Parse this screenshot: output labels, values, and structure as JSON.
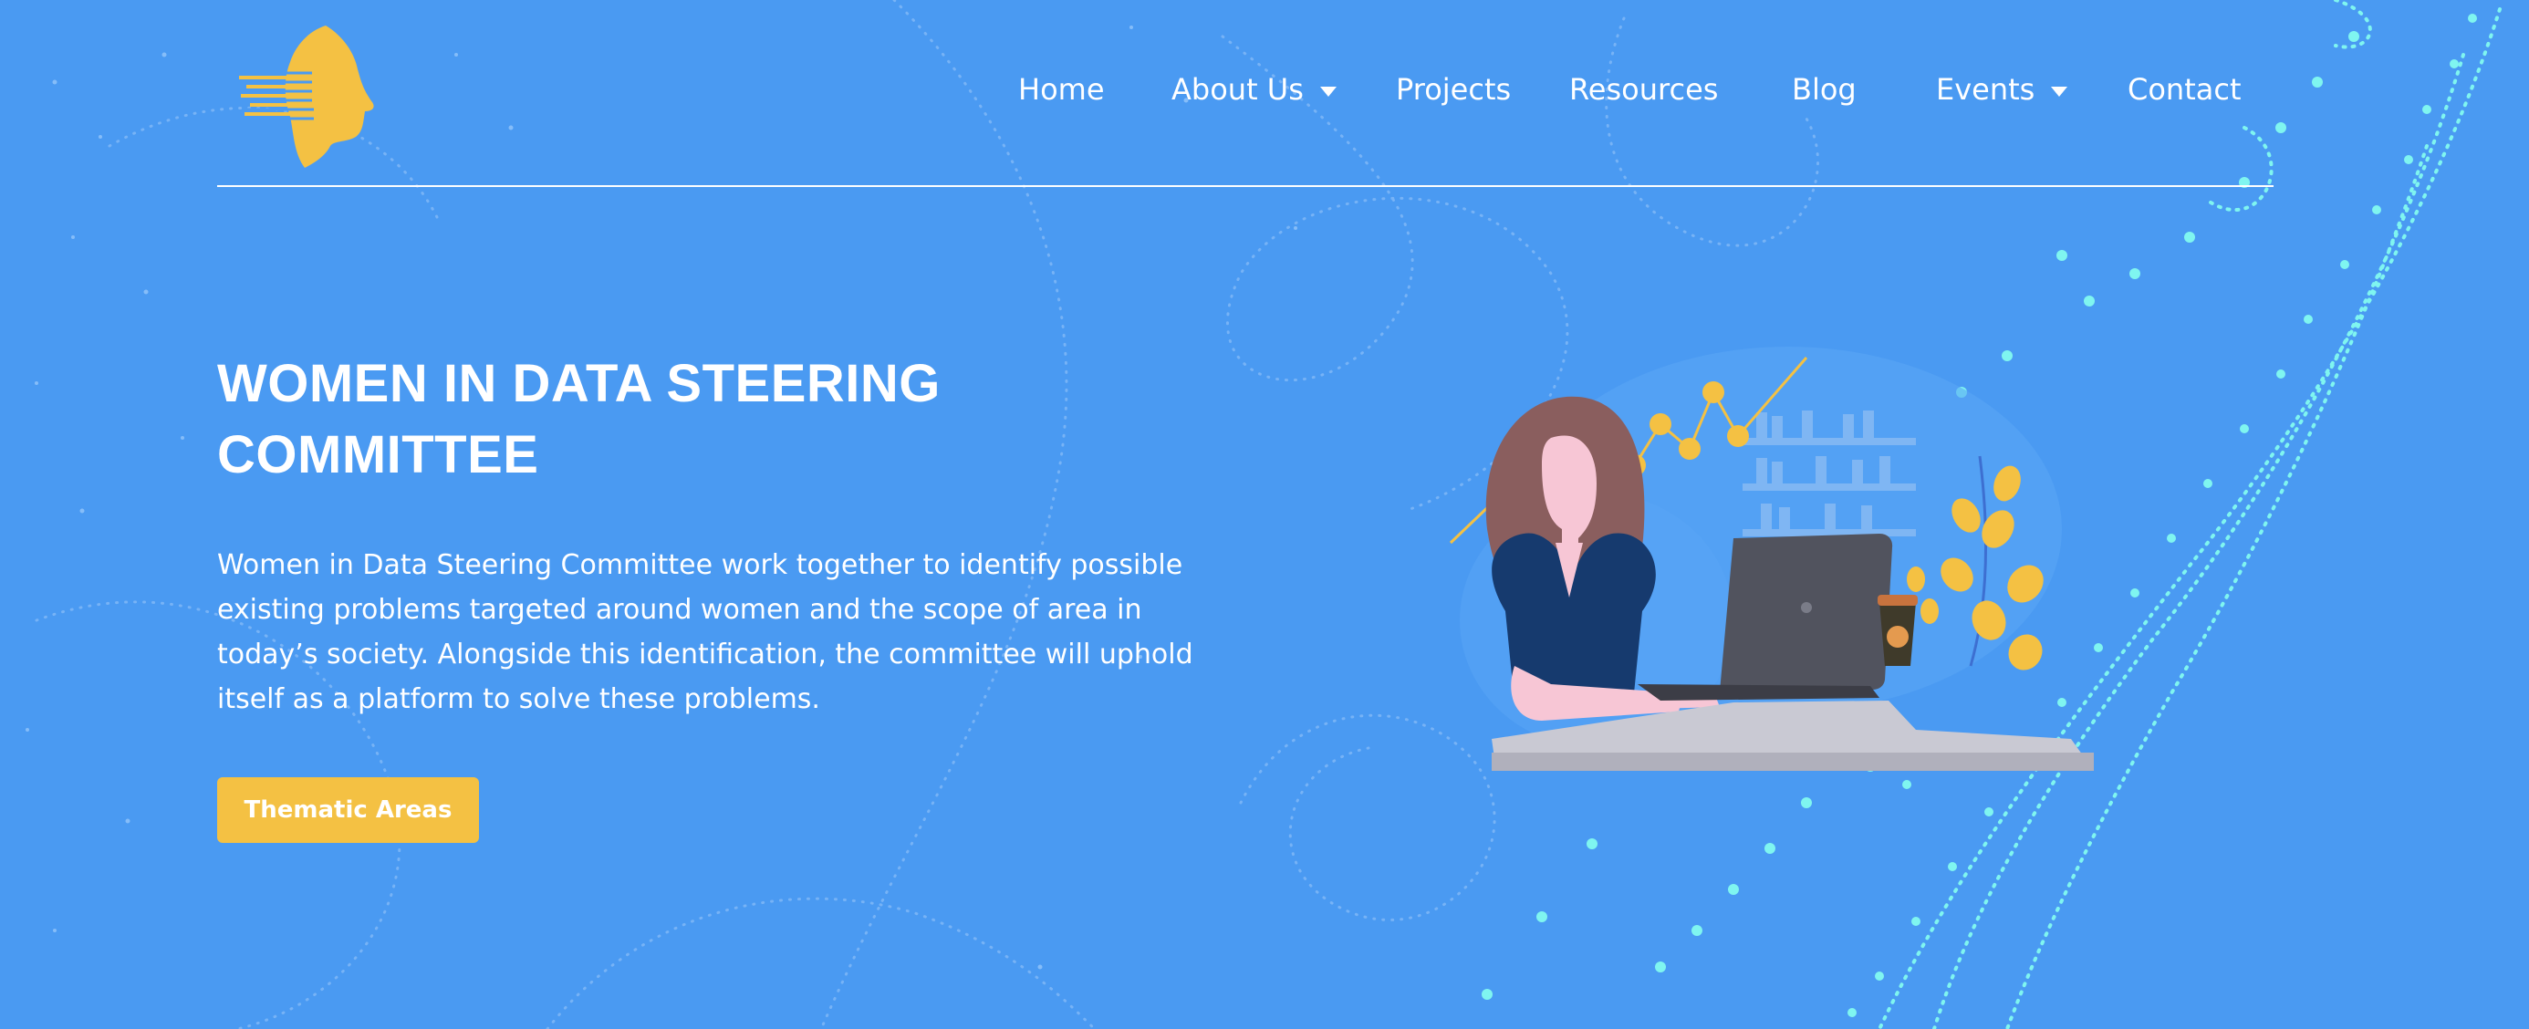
{
  "brand": {
    "logo": "woman-profile-logo"
  },
  "nav": {
    "items": [
      {
        "label": "Home"
      },
      {
        "label": "About Us",
        "icon": "caret-down-icon"
      },
      {
        "label": "Projects"
      },
      {
        "label": "Resources"
      },
      {
        "label": "Blog"
      },
      {
        "label": "Events",
        "icon": "caret-down-icon"
      },
      {
        "label": "Contact"
      }
    ]
  },
  "hero": {
    "title_line1": "WOMEN IN DATA STEERING",
    "title_line2": "COMMITTEE",
    "description_lines": [
      "Women in Data Steering Committee work together to identify possible",
      "existing problems targeted around women and the scope of area in",
      "today’s society. Alongside this identification, the committee will uphold",
      "itself as a platform to solve these problems."
    ],
    "cta_label": "Thematic Areas"
  },
  "illustration": {
    "subject": "woman-working-on-laptop-illustration"
  },
  "colors": {
    "background": "#4a9af2",
    "accent_yellow": "#f4c143",
    "particles_cyan": "#7ff5f0",
    "text": "#ffffff"
  }
}
